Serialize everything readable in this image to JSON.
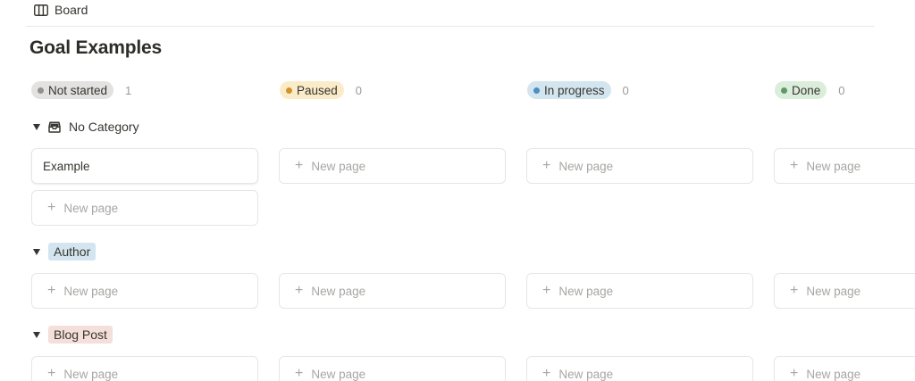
{
  "view": {
    "label": "Board",
    "icon": "board-icon"
  },
  "page": {
    "title": "Goal Examples"
  },
  "columns": [
    {
      "label": "Not started",
      "count": "1",
      "bg": "#e3e2e0",
      "dot": "#91918e"
    },
    {
      "label": "Paused",
      "count": "0",
      "bg": "#fbecc9",
      "dot": "#d4922b"
    },
    {
      "label": "In progress",
      "count": "0",
      "bg": "#d3e5ef",
      "dot": "#4a90c2"
    },
    {
      "label": "Done",
      "count": "0",
      "bg": "#dbeddb",
      "dot": "#5b9a68"
    }
  ],
  "groups": [
    {
      "label": "No Category",
      "icon": "inbox-icon",
      "tag_bg": ""
    },
    {
      "label": "Author",
      "tag_bg": "#d3e5ef"
    },
    {
      "label": "Blog Post",
      "tag_bg": "#f4dfdb"
    }
  ],
  "cards": {
    "example_title": "Example",
    "new_page_label": "New page",
    "plus_glyph": "+"
  }
}
